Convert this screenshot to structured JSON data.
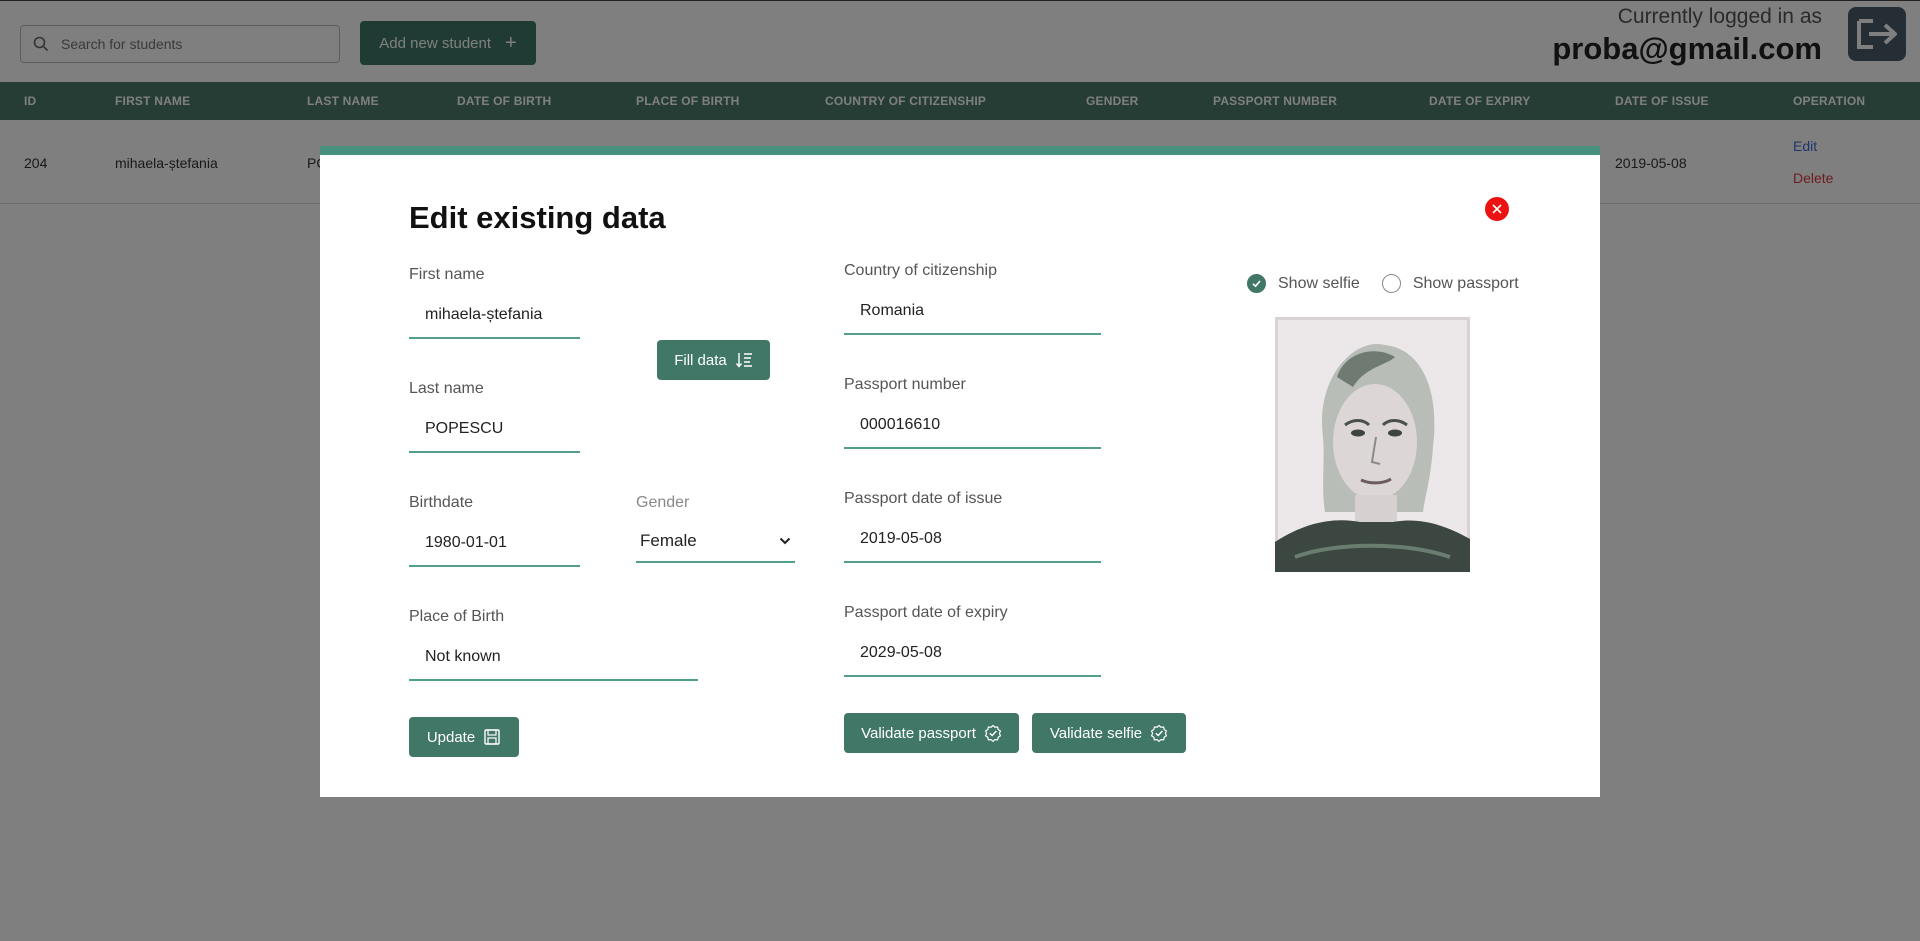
{
  "search": {
    "placeholder": "Search for students"
  },
  "toolbar": {
    "add_student_label": "Add new student",
    "add_icon": "+"
  },
  "session": {
    "logged_in_label": "Currently logged in as",
    "email": "proba@gmail.com"
  },
  "table": {
    "headers": [
      "ID",
      "FIRST NAME",
      "LAST NAME",
      "DATE OF BIRTH",
      "PLACE OF BIRTH",
      "COUNTRY OF CITIZENSHIP",
      "GENDER",
      "PASSPORT NUMBER",
      "DATE OF EXPIRY",
      "DATE OF ISSUE",
      "OPERATION"
    ],
    "row": {
      "id": "204",
      "first_name": "mihaela-ștefania",
      "last_name_partial": "PC",
      "date_of_issue": "2019-05-08",
      "edit_label": "Edit",
      "delete_label": "Delete"
    }
  },
  "modal": {
    "title": "Edit existing data",
    "first_name": {
      "label": "First name",
      "value": "mihaela-ștefania"
    },
    "last_name": {
      "label": "Last name",
      "value": "POPESCU"
    },
    "birthdate": {
      "label": "Birthdate",
      "value": "1980-01-01"
    },
    "gender": {
      "label": "Gender",
      "value": "Female"
    },
    "place_of_birth": {
      "label": "Place of Birth",
      "value": "Not known"
    },
    "country": {
      "label": "Country of citizenship",
      "value": "Romania"
    },
    "passport_number": {
      "label": "Passport number",
      "value": "000016610"
    },
    "passport_issue": {
      "label": "Passport date of issue",
      "value": "2019-05-08"
    },
    "passport_expiry": {
      "label": "Passport date of expiry",
      "value": "2029-05-08"
    },
    "fill_data_label": "Fill data",
    "update_label": "Update",
    "validate_passport_label": "Validate passport",
    "validate_selfie_label": "Validate selfie",
    "show_selfie_label": "Show selfie",
    "show_passport_label": "Show passport",
    "show_selfie_checked": true
  },
  "colors": {
    "accent": "#417767",
    "header": "#4d7a6c",
    "underline": "#52a08b",
    "close": "#ee1111"
  }
}
